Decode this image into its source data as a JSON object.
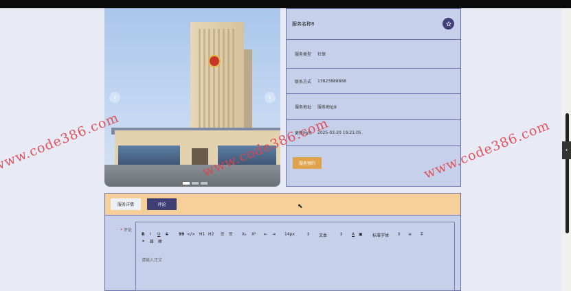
{
  "carousel": {
    "prev_icon": "‹",
    "next_icon": "›",
    "dots": [
      true,
      false,
      false
    ]
  },
  "service": {
    "name": "服务名称8",
    "type_label": "服务类型",
    "type_value": "社保",
    "contact_label": "联系方式",
    "contact_value": "13823888888",
    "address_label": "服务地址",
    "address_value": "服务地址8",
    "updated_label": "更新时间",
    "updated_value": "2025-03-20 19:21:05",
    "book_button": "服务预约",
    "fav_icon": "star-icon"
  },
  "tabs": {
    "detail": "服务详情",
    "review": "评论"
  },
  "review": {
    "required_mark": "*",
    "label": "评论",
    "placeholder": "请输入正文",
    "toolbar": {
      "font_size": "14px",
      "text_style": "文本",
      "font_family": "标准字体",
      "bold": "B",
      "italic": "I",
      "underline": "U",
      "strike": "S",
      "quote": "99",
      "code": "</>",
      "h1": "H1",
      "h2": "H2",
      "sub": "X₂",
      "sup": "X²"
    }
  },
  "watermark": "www.code386.com",
  "side_tab": "‹"
}
